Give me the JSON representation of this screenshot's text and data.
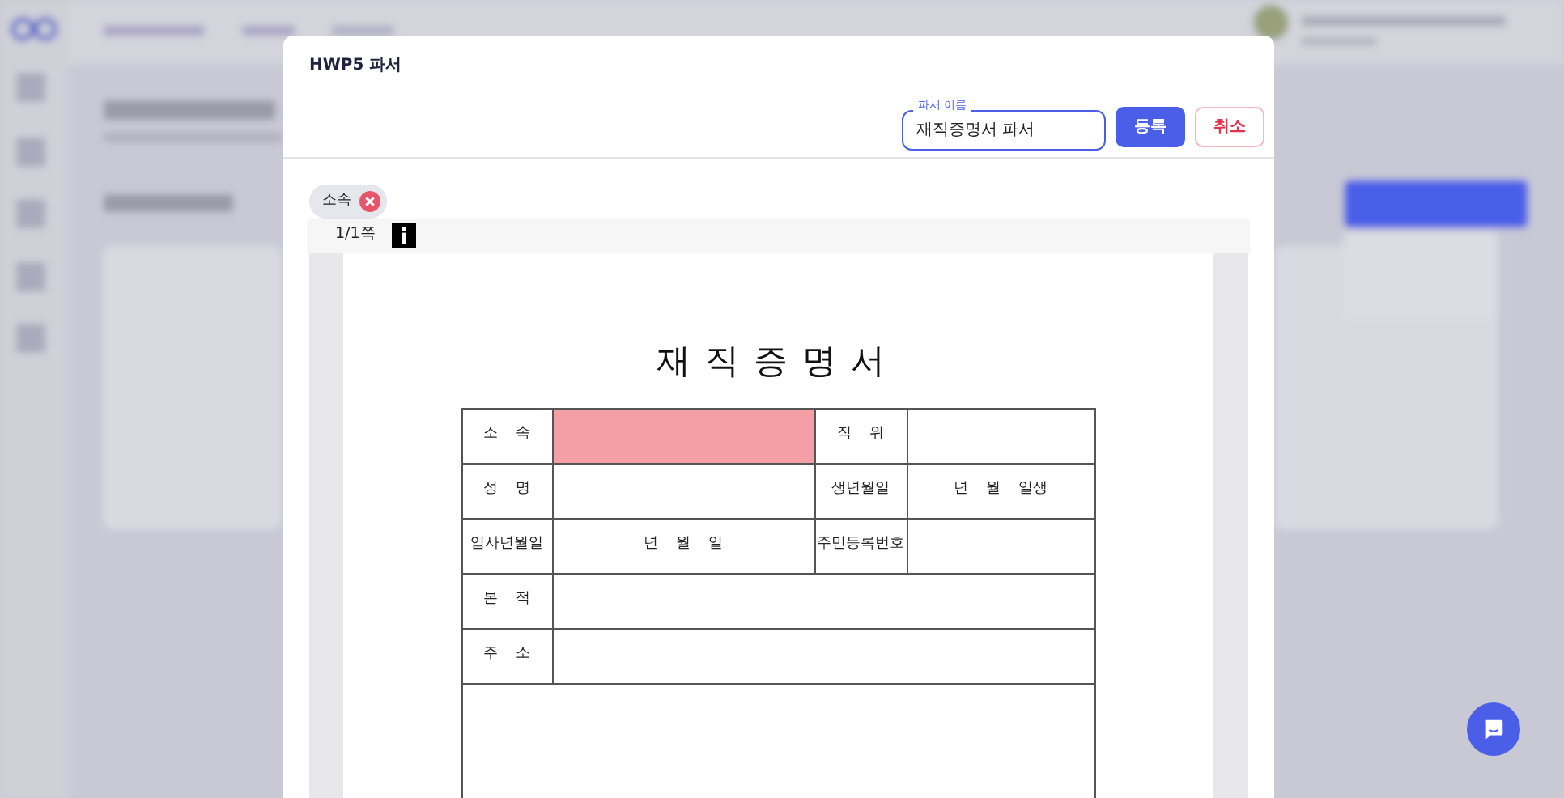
{
  "dialog": {
    "title": "HWP5 파서",
    "name_field": {
      "label": "파서 이름",
      "value": "재직증명서 파서"
    },
    "buttons": [
      {
        "kind": "primary",
        "label": "등록"
      },
      {
        "kind": "cancel",
        "label": "취소"
      }
    ],
    "tags": [
      {
        "label": "소속",
        "removable": true
      }
    ],
    "viewer": {
      "page": "1/1쪽",
      "document": {
        "title": "재직증명서",
        "rows": [
          {
            "cells": [
              {
                "text": "소 속",
                "highlighted": false
              },
              {
                "highlighted": true
              },
              {
                "text": "직 위",
                "highlighted": false
              },
              {
                "highlighted": false
              }
            ]
          },
          {
            "cells": [
              {
                "text": "성 명",
                "highlighted": false
              },
              {
                "highlighted": false
              },
              {
                "text": "생년월일",
                "highlighted": false
              },
              {
                "text": "년 월 일생",
                "highlighted": false
              }
            ]
          },
          {
            "cells": [
              {
                "text": "입사년월일",
                "highlighted": false
              },
              {
                "text": "년 월 일",
                "highlighted": false
              },
              {
                "text": "주민등록번호",
                "highlighted": false
              },
              {
                "highlighted": false
              }
            ]
          },
          {
            "cells": [
              {
                "text": "본 적",
                "highlighted": false
              },
              {
                "highlighted": false
              }
            ]
          },
          {
            "cells": [
              {
                "text": "주 소",
                "highlighted": false
              },
              {
                "highlighted": false
              }
            ]
          }
        ]
      }
    }
  }
}
